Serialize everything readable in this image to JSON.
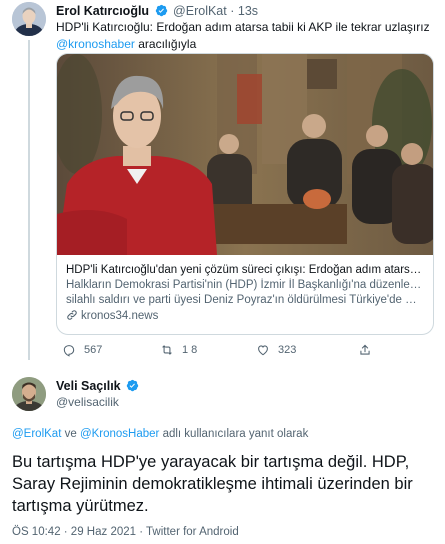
{
  "quoted_tweet": {
    "author_name": "Erol Katırcıoğlu",
    "author_handle": "@ErolKat",
    "separator": "·",
    "time": "13s",
    "text_before_mention": "HDP'li Katırcıoğlu: Erdoğan adım atarsa tabii ki AKP ile tekrar uzlaşırız",
    "mention": "@kronoshaber",
    "text_after_mention": " aracılığıyla",
    "card": {
      "title": "HDP'li Katırcıoğlu'dan yeni çözüm süreci çıkışı: Erdoğan adım atarsa ta...",
      "description_line1": "Halkların Demokrasi Partisi'nin (HDP) İzmir İl Başkanlığı'na düzenlenen",
      "description_line2": "silahlı saldırı ve parti üyesi Deniz Poyraz'ın öldürülmesi Türkiye'de mafy...",
      "domain": "kronos34.news",
      "link_icon": "link-icon"
    },
    "actions": {
      "reply_count": "567",
      "retweet_count": "1 8",
      "like_count": "323"
    }
  },
  "main_tweet": {
    "author_name": "Veli Saçılık",
    "author_handle": "@velisacilik",
    "reply_mention1": "@ErolKat",
    "reply_connector": " ve ",
    "reply_mention2": "@KronosHaber",
    "reply_suffix": " adlı kullanıcılara yanıt olarak",
    "text": "Bu tartışma HDP'ye yarayacak bir tartışma değil. HDP, Saray Rejiminin demokratikleşme ihtimali üzerinden bir tartışma yürütmez.",
    "meta": "ÖS 10:42 · 29 Haz 2021 · Twitter for Android"
  },
  "colors": {
    "accent": "#1d9bf0",
    "text": "#0f1419",
    "secondary": "#536471",
    "border": "#cfd9de"
  }
}
